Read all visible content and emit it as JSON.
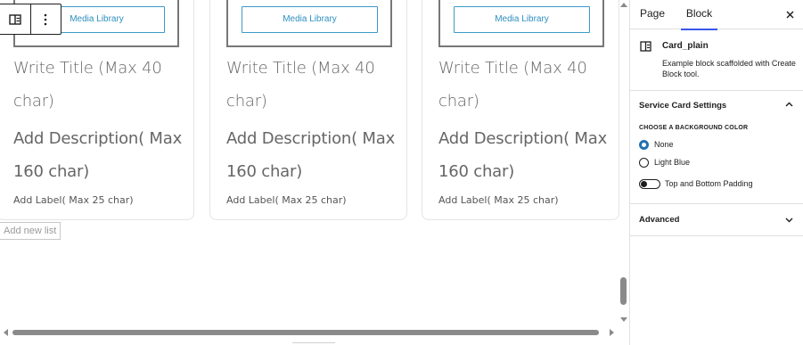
{
  "canvas": {
    "cards": [
      {
        "media_button": "Media Library",
        "title": "Write Title (Max 40 char)",
        "description": "Add Description( Max 160 char)",
        "label": "Add Label( Max 25 char)"
      },
      {
        "media_button": "Media Library",
        "title": "Write Title (Max 40 char)",
        "description": "Add Description( Max 160 char)",
        "label": "Add Label( Max 25 char)"
      },
      {
        "media_button": "Media Library",
        "title": "Write Title (Max 40 char)",
        "description": "Add Description( Max 160 char)",
        "label": "Add Label( Max 25 char)"
      }
    ],
    "toolbar": {
      "block_icon": "block-type-icon",
      "options_icon": "more-vertical-icon"
    },
    "add_new_list": "Add new list"
  },
  "sidebar": {
    "tabs": [
      {
        "label": "Page",
        "active": false
      },
      {
        "label": "Block",
        "active": true
      }
    ],
    "close_icon": "close-icon",
    "block_card": {
      "icon": "block-icon",
      "title": "Card_plain",
      "description": "Example block scaffolded with Create Block tool."
    },
    "panels": [
      {
        "title": "Service Card Settings",
        "expanded": true,
        "background_caption": "CHOOSE A BACKGROUND COLOR",
        "options": [
          {
            "label": "None",
            "checked": true
          },
          {
            "label": "Light Blue",
            "checked": false
          }
        ],
        "toggle": {
          "label": "Top and Bottom Padding",
          "on": false
        }
      },
      {
        "title": "Advanced",
        "expanded": false
      }
    ]
  },
  "colors": {
    "accent": "#3858e9",
    "radio_checked": "#2271b1",
    "media_button": "#2f8fc0"
  }
}
